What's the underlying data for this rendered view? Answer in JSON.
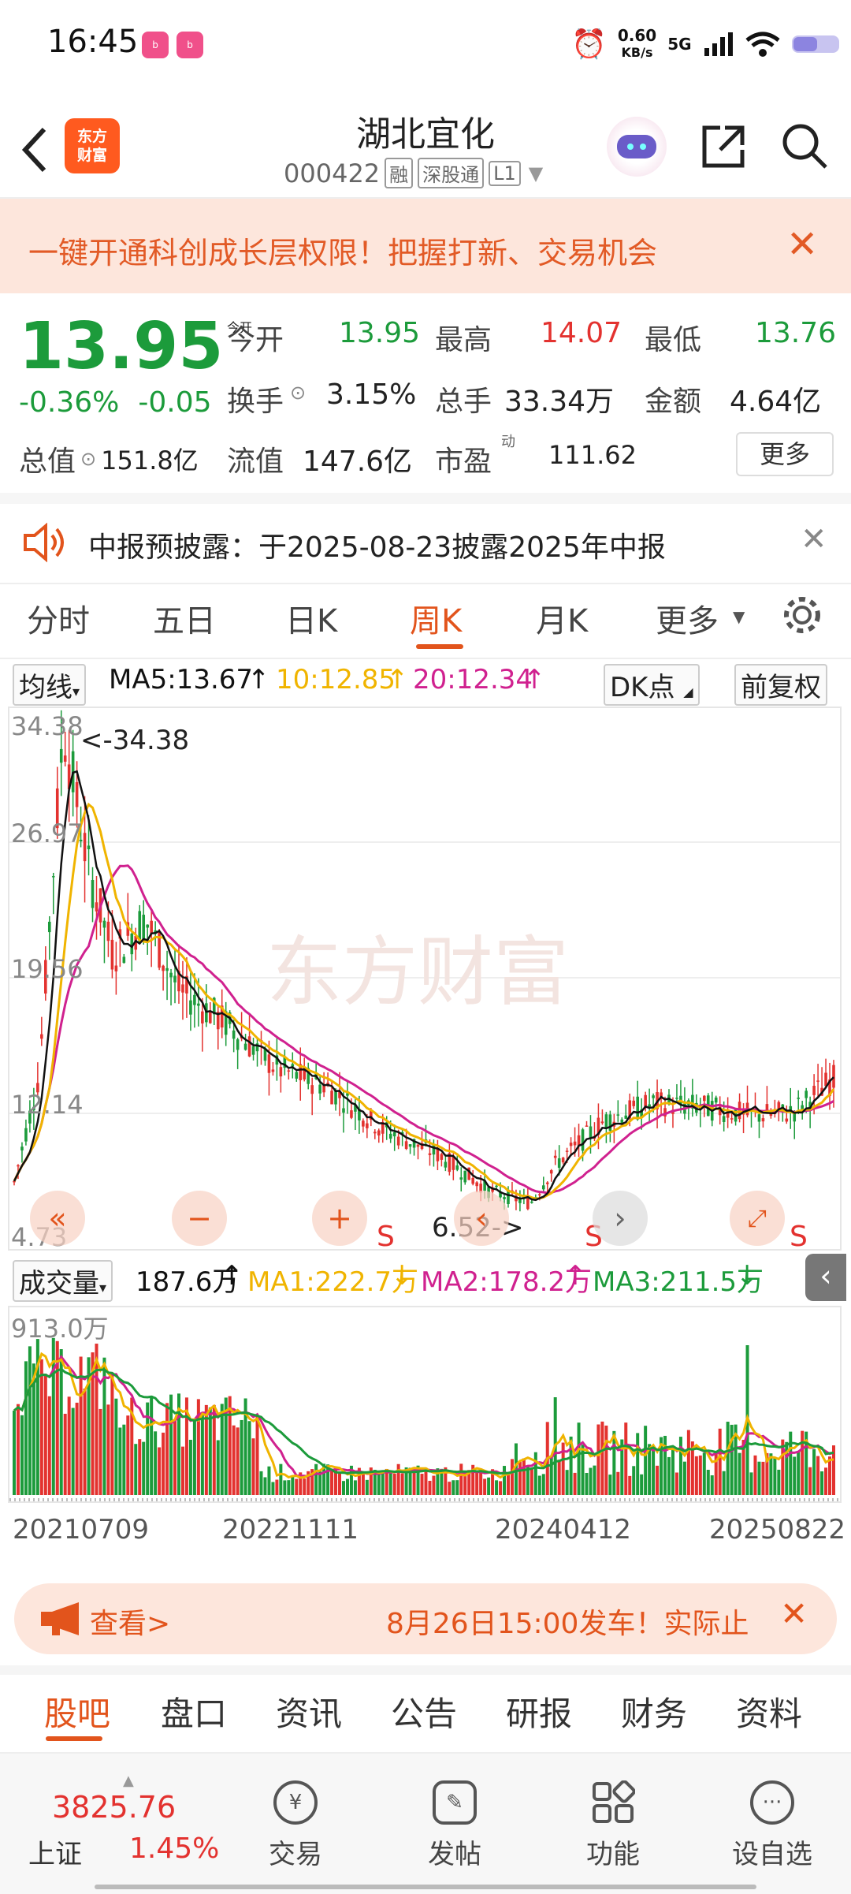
{
  "status": {
    "time": "16:45",
    "apps": [
      "bilibili",
      "bilibili"
    ],
    "speed": "0.60",
    "speed_unit": "KB/s",
    "network": "5G"
  },
  "header": {
    "logo_line1": "东方",
    "logo_line2": "财富",
    "title": "湖北宜化",
    "code": "000422",
    "tags": [
      "融",
      "深股通",
      "L1"
    ]
  },
  "banner": {
    "text": "一键开通科创成长层权限！把握打新、交易机会"
  },
  "quote": {
    "price": "13.95",
    "change_pct": "-0.36%",
    "change": "-0.05",
    "open_label": "今开",
    "open": "13.95",
    "high_label": "最高",
    "high": "14.07",
    "low_label": "最低",
    "low": "13.76",
    "turnover_label": "换手",
    "turnover": "3.15%",
    "volume_label": "总手",
    "volume": "33.34万",
    "amount_label": "金额",
    "amount": "4.64亿",
    "mktcap_label": "总值",
    "mktcap": "151.8亿",
    "float_label": "流值",
    "float": "147.6亿",
    "pe_label": "市盈",
    "pe_sup": "动",
    "pe": "111.62",
    "more": "更多"
  },
  "notice": {
    "text": "中报预披露：于2025-08-23披露2025年中报"
  },
  "chart_tabs": [
    {
      "label": "分时"
    },
    {
      "label": "五日"
    },
    {
      "label": "日K"
    },
    {
      "label": "周K"
    },
    {
      "label": "月K"
    },
    {
      "label": "更多"
    }
  ],
  "ma_bar": {
    "type": "均线",
    "ma5": "MA5:13.67",
    "ma10": "10:12.85",
    "ma20": "20:12.34",
    "dk": "DK点",
    "adjust": "前复权"
  },
  "price_chart": {
    "axis_labels": [
      "34.38",
      "26.97",
      "19.56",
      "12.14",
      "4.73"
    ],
    "max_note": "<-34.38",
    "min_note": "6.52->",
    "s_marks": [
      "S",
      "S",
      "S"
    ],
    "watermark": "东方财富"
  },
  "vol_bar": {
    "type": "成交量",
    "value": "187.6万",
    "ma1": "MA1:222.7万",
    "ma2": "MA2:178.2万",
    "ma3": "MA3:211.5万",
    "top": "913.0万"
  },
  "dates": [
    "20210709",
    "20221111",
    "20240412",
    "20250822"
  ],
  "promo": {
    "label": "查看>",
    "text": "8月26日15:00发车！实际止"
  },
  "bottom_tabs": [
    {
      "label": "股吧"
    },
    {
      "label": "盘口"
    },
    {
      "label": "资讯"
    },
    {
      "label": "公告"
    },
    {
      "label": "研报"
    },
    {
      "label": "财务"
    },
    {
      "label": "资料"
    }
  ],
  "index": {
    "value": "3825.76",
    "name": "上证",
    "pct": "1.45%"
  },
  "nav": [
    {
      "label": "交易",
      "icon": "trade-icon"
    },
    {
      "label": "发帖",
      "icon": "edit-icon"
    },
    {
      "label": "功能",
      "icon": "grid-icon"
    },
    {
      "label": "设自选",
      "icon": "more-icon"
    }
  ],
  "colors": {
    "up": "#e3322f",
    "down": "#1c9b3b",
    "accent": "#e2541c",
    "ma5": "#111111",
    "ma10": "#f0b400",
    "ma20": "#d0218f"
  }
}
